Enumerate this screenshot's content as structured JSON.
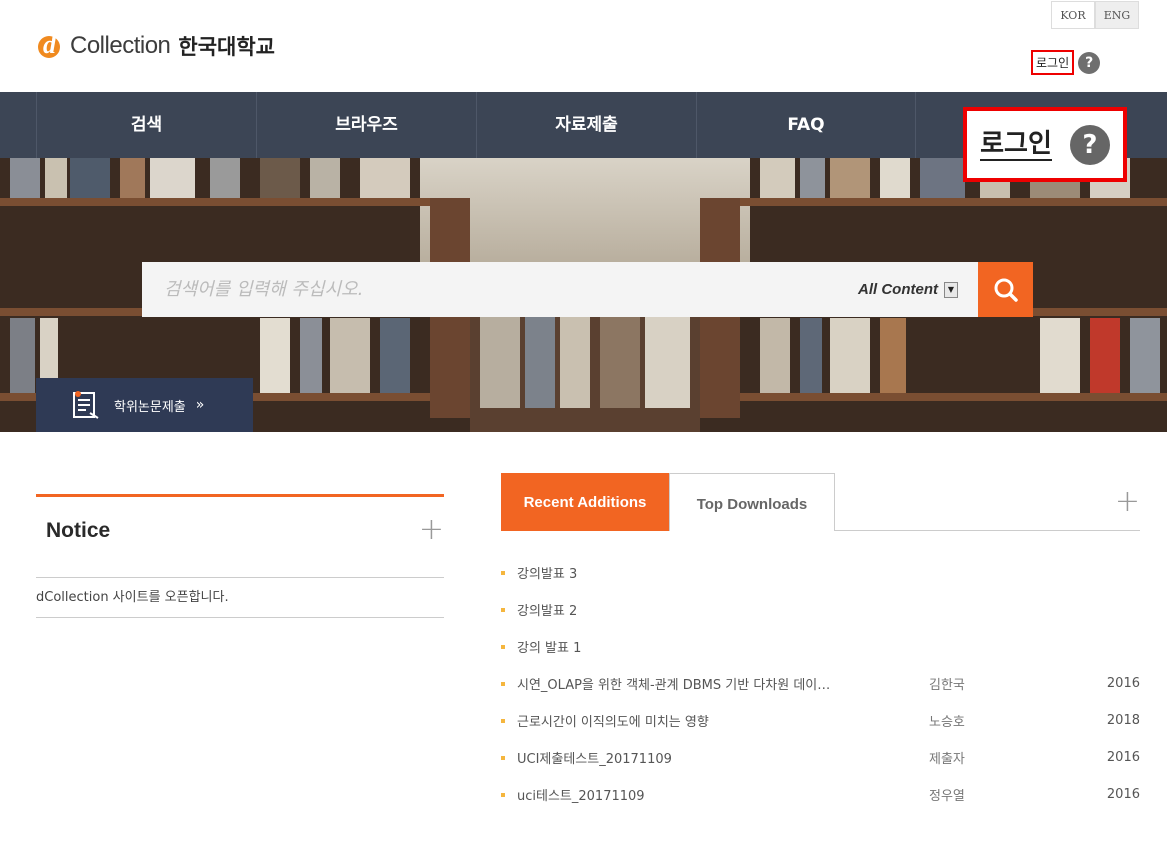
{
  "brand": {
    "logo_letter": "d",
    "name": "Collection",
    "university": "한국대학교"
  },
  "lang": [
    "KOR",
    "ENG"
  ],
  "header": {
    "login_label": "로그인",
    "help_icon": "?"
  },
  "nav": {
    "items": [
      "검색",
      "브라우즈",
      "자료제출",
      "FAQ"
    ],
    "login_label": "로그인",
    "help_icon": "?"
  },
  "search": {
    "placeholder": "검색어를 입력해 주십시오.",
    "scope": "All Content",
    "scope_arrow": "▼"
  },
  "thesis_button": {
    "label": "학위논문제출",
    "arrow": "»"
  },
  "notice": {
    "title": "Notice",
    "plus": "+",
    "items": [
      "dCollection 사이트를 오픈합니다."
    ]
  },
  "tabs": {
    "recent": "Recent Additions",
    "top": "Top Downloads",
    "plus": "+"
  },
  "recent": [
    {
      "title": "강의발표 3",
      "author": "",
      "year": ""
    },
    {
      "title": "강의발표 2",
      "author": "",
      "year": ""
    },
    {
      "title": "강의 발표 1",
      "author": "",
      "year": ""
    },
    {
      "title": "시연_OLAP을 위한 객체-관계 DBMS 기반 다차원 데이…",
      "author": "김한국",
      "year": "2016"
    },
    {
      "title": "근로시간이 이직의도에 미치는 영향",
      "author": "노승호",
      "year": "2018"
    },
    {
      "title": "UCI제출테스트_20171109",
      "author": "제출자",
      "year": "2016"
    },
    {
      "title": "uci테스트_20171109",
      "author": "정우열",
      "year": "2016"
    }
  ],
  "colors": {
    "accent": "#f26522",
    "nav_bg": "#3c4555",
    "thesis_bg": "#2f3a55",
    "highlight": "#ee0000"
  }
}
